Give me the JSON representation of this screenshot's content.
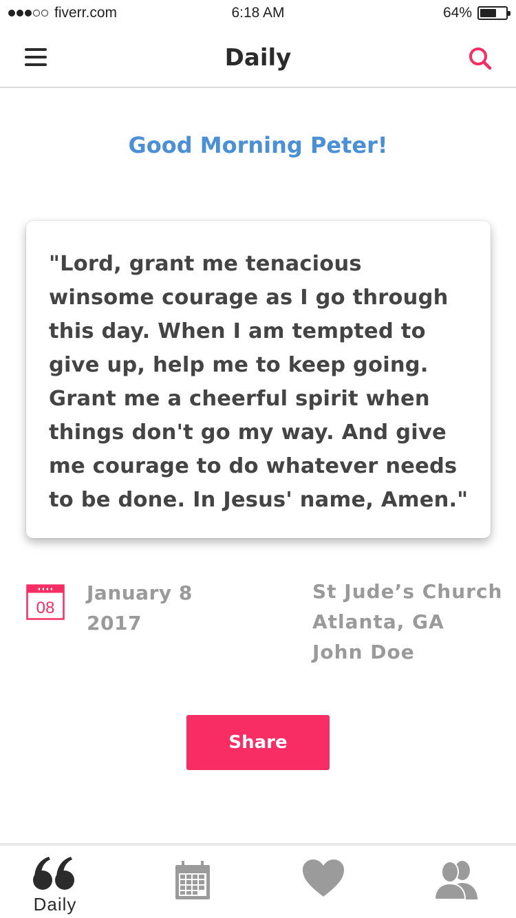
{
  "status_bar": {
    "carrier": "fiverr.com",
    "time": "6:18 AM",
    "battery_percent": "64%",
    "battery_level": 0.64,
    "signal_bars": 3,
    "signal_total": 5
  },
  "nav": {
    "title": "Daily",
    "menu_icon": "hamburger-menu-icon",
    "search_icon": "search-icon"
  },
  "greeting": "Good Morning Peter!",
  "prayer": {
    "text": "\"Lord, grant me tenacious winsome courage as I go through this day. When I am tempted to give up, help me to keep going. Grant me a cheerful spirit when things don't go my way. And give me courage to do whatever needs to be done. In Jesus' name, Amen.\""
  },
  "info": {
    "calendar_icon": "calendar-icon",
    "calendar_day": "08",
    "date_line1": "January 8",
    "date_line2": "2017",
    "church_name": "St Jude’s Church",
    "church_location": "Atlanta, GA",
    "author": "John Doe"
  },
  "share_button": "Share",
  "tabs": [
    {
      "label": "Daily",
      "icon": "quote-icon",
      "active": true
    },
    {
      "label": "",
      "icon": "calendar-icon",
      "active": false
    },
    {
      "label": "",
      "icon": "heart-icon",
      "active": false
    },
    {
      "label": "",
      "icon": "people-icon",
      "active": false
    }
  ],
  "colors": {
    "accent_pink": "#f82d63",
    "greeting_blue": "#4a90d9",
    "muted_gray": "#9a9a9a",
    "dark_text": "#2b2b2b"
  }
}
